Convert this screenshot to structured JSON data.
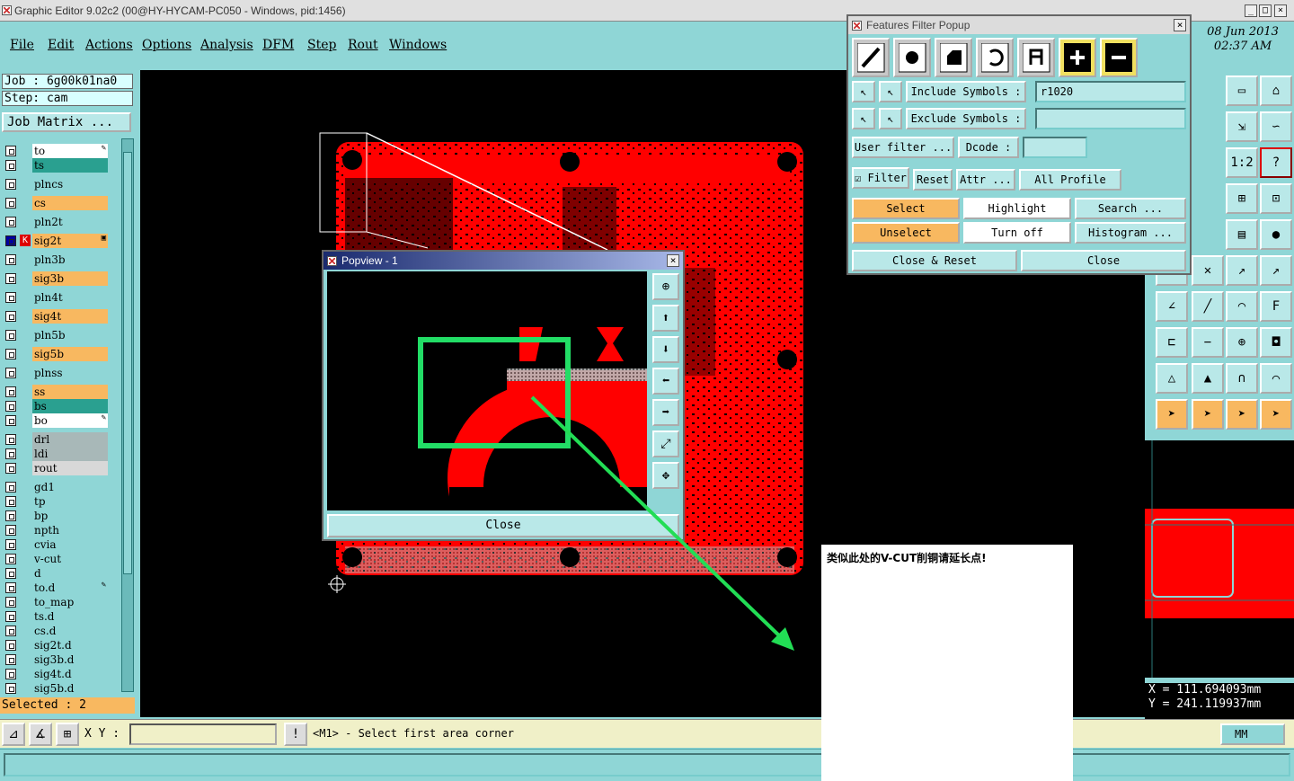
{
  "app": {
    "title": "Graphic Editor 9.02c2 (00@HY-HYCAM-PC050 - Windows, pid:1456)"
  },
  "menu": [
    "File",
    "Edit",
    "Actions",
    "Options",
    "Analysis",
    "DFM",
    "Step",
    "Rout",
    "Windows"
  ],
  "date": {
    "day": "08 Jun 2013",
    "time": "02:37 AM"
  },
  "job": {
    "job_label": "Job  :  6g00k01na0",
    "step_label": "Step:  cam",
    "matrix_button": "Job Matrix ..."
  },
  "layers": [
    {
      "name": "to",
      "color": "#ffffff",
      "mark": "✎"
    },
    {
      "name": "ts",
      "color": "#2aa090",
      "mark": ""
    },
    {
      "name": "plncs",
      "color": "#8fd6d6",
      "mark": ""
    },
    {
      "name": "cs",
      "color": "#f8b860",
      "mark": ""
    },
    {
      "name": "pln2t",
      "color": "#8fd6d6",
      "mark": ""
    },
    {
      "name": "sig2t",
      "color": "#f8b860",
      "mark": "▣"
    },
    {
      "name": "pln3b",
      "color": "#8fd6d6",
      "mark": ""
    },
    {
      "name": "sig3b",
      "color": "#f8b860",
      "mark": ""
    },
    {
      "name": "pln4t",
      "color": "#8fd6d6",
      "mark": ""
    },
    {
      "name": "sig4t",
      "color": "#f8b860",
      "mark": ""
    },
    {
      "name": "pln5b",
      "color": "#8fd6d6",
      "mark": ""
    },
    {
      "name": "sig5b",
      "color": "#f8b860",
      "mark": ""
    },
    {
      "name": "plnss",
      "color": "#8fd6d6",
      "mark": ""
    },
    {
      "name": "ss",
      "color": "#f8b860",
      "mark": ""
    },
    {
      "name": "bs",
      "color": "#2aa090",
      "mark": ""
    },
    {
      "name": "bo",
      "color": "#ffffff",
      "mark": "✎"
    },
    {
      "name": "drl",
      "color": "#a8b8b8",
      "mark": ""
    },
    {
      "name": "ldi",
      "color": "#a8b8b8",
      "mark": ""
    },
    {
      "name": "rout",
      "color": "#d8d8d8",
      "mark": ""
    },
    {
      "name": "gd1",
      "color": "#8fd6d6",
      "mark": ""
    },
    {
      "name": "tp",
      "color": "#8fd6d6",
      "mark": ""
    },
    {
      "name": "bp",
      "color": "#8fd6d6",
      "mark": ""
    },
    {
      "name": "npth",
      "color": "#8fd6d6",
      "mark": ""
    },
    {
      "name": "cvia",
      "color": "#8fd6d6",
      "mark": ""
    },
    {
      "name": "v-cut",
      "color": "#8fd6d6",
      "mark": ""
    },
    {
      "name": "d",
      "color": "#8fd6d6",
      "mark": ""
    },
    {
      "name": "to.d",
      "color": "#8fd6d6",
      "mark": "✎"
    },
    {
      "name": "to_map",
      "color": "#8fd6d6",
      "mark": ""
    },
    {
      "name": "ts.d",
      "color": "#8fd6d6",
      "mark": ""
    },
    {
      "name": "cs.d",
      "color": "#8fd6d6",
      "mark": ""
    },
    {
      "name": "sig2t.d",
      "color": "#8fd6d6",
      "mark": ""
    },
    {
      "name": "sig3b.d",
      "color": "#8fd6d6",
      "mark": ""
    },
    {
      "name": "sig4t.d",
      "color": "#8fd6d6",
      "mark": ""
    },
    {
      "name": "sig5b.d",
      "color": "#8fd6d6",
      "mark": ""
    }
  ],
  "selected": "Selected : 2",
  "bottom": {
    "xy_label": "X Y :",
    "message": "<M1> - Select first area corner",
    "units": "MM"
  },
  "coords": {
    "x": "X  =  111.694093mm",
    "y": "Y  =  241.119937mm"
  },
  "filter_popup": {
    "title": "Features Filter Popup",
    "include_label": "Include Symbols :",
    "include_value": "r1020",
    "exclude_label": "Exclude Symbols :",
    "exclude_value": "",
    "user_filter": "User filter ...",
    "dcode": "Dcode :",
    "filter": "Filter",
    "reset": "Reset",
    "attr": "Attr ...",
    "all_profile": "All Profile",
    "select": "Select",
    "highlight": "Highlight",
    "search": "Search ...",
    "unselect": "Unselect",
    "turn_off": "Turn off",
    "histogram": "Histogram ...",
    "close_reset": "Close & Reset",
    "close": "Close"
  },
  "popview": {
    "title": "Popview - 1",
    "close": "Close"
  },
  "note": {
    "text": "类似此处的V-CUT削铜请延长点!"
  },
  "colors": {
    "board": "#ff0000",
    "highlight_box": "#22dd66",
    "arrow": "#22dd55"
  }
}
